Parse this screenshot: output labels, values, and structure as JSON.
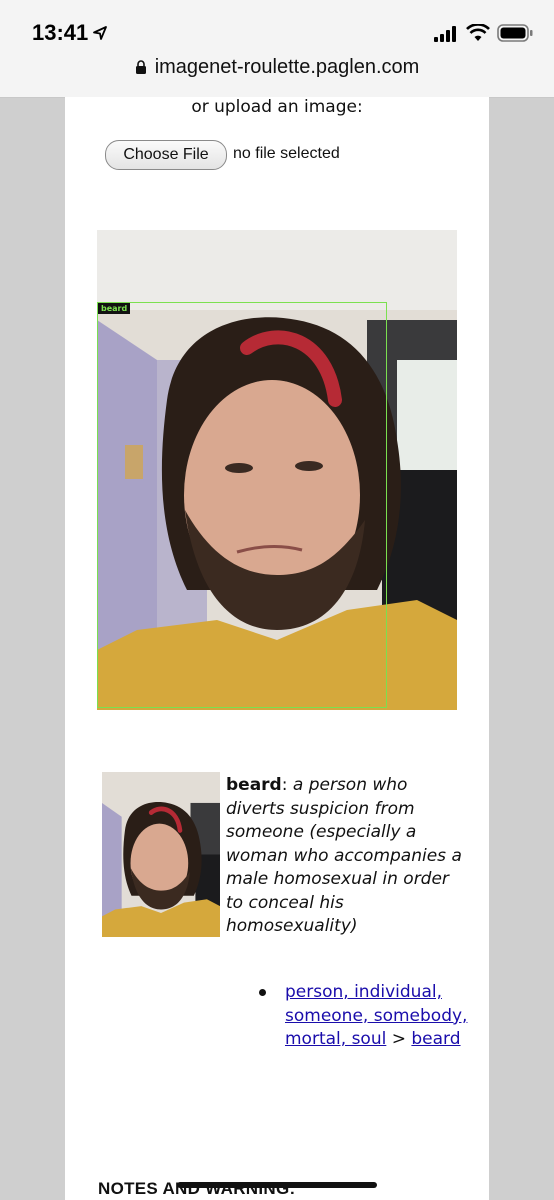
{
  "status_bar": {
    "time": "13:41"
  },
  "url_bar": {
    "domain": "imagenet-roulette.paglen.com"
  },
  "upload": {
    "label": "or upload an image:",
    "button_label": "Choose File",
    "file_status": "no file selected"
  },
  "detection": {
    "box_label": "beard",
    "box_color": "#7be050"
  },
  "result": {
    "term": "beard",
    "separator": ": ",
    "definition": "a person who diverts suspicion from someone (especially a woman who accompanies a male homosexual in order to conceal his homosexuality)",
    "hierarchy_link": "person, individual, someone, somebody, mortal, soul",
    "hierarchy_sep": " > ",
    "hierarchy_leaf": "beard"
  },
  "notes_heading": "NOTES AND WARNING:",
  "colors": {
    "link": "#1a0dab",
    "page_bg": "#ffffff",
    "gutter": "#cfcfcf"
  }
}
